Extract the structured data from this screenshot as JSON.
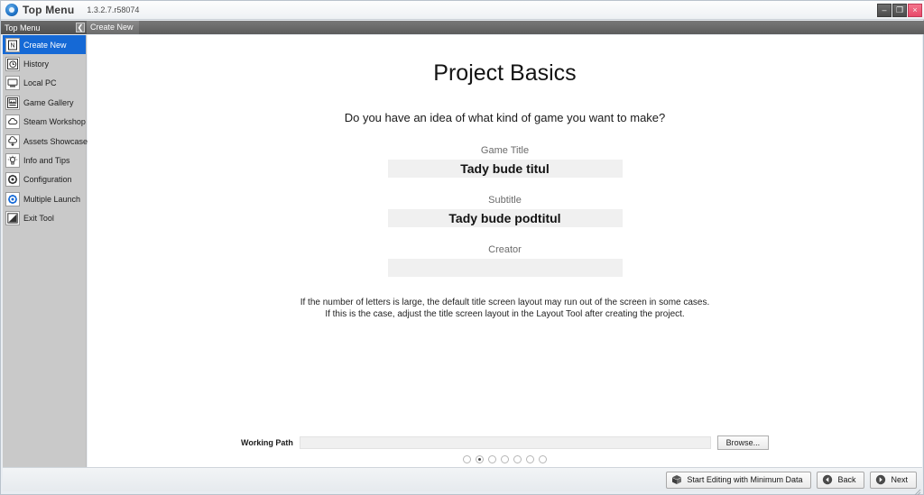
{
  "titlebar": {
    "app_title": "Top Menu",
    "version": "1.3.2.7.r58074",
    "app_icon": "gear-blue-icon",
    "minimize_label": "–",
    "maximize_label": "❐",
    "close_label": "×"
  },
  "subbar": {
    "panel_title": "Top Menu",
    "collapse_label": "❮",
    "tabs": [
      {
        "label": "Create New",
        "active": true
      }
    ]
  },
  "sidebar": {
    "items": [
      {
        "label": "Create New",
        "icon": "new-document-icon",
        "active": true
      },
      {
        "label": "History",
        "icon": "clock-history-icon",
        "active": false
      },
      {
        "label": "Local PC",
        "icon": "monitor-icon",
        "active": false
      },
      {
        "label": "Game Gallery",
        "icon": "gallery-image-icon",
        "active": false
      },
      {
        "label": "Steam Workshop",
        "icon": "cloud-icon",
        "active": false
      },
      {
        "label": "Assets Showcase",
        "icon": "cloud-download-icon",
        "active": false
      },
      {
        "label": "Info and Tips",
        "icon": "lightbulb-icon",
        "active": false
      },
      {
        "label": "Configuration",
        "icon": "gear-icon",
        "active": false
      },
      {
        "label": "Multiple Launch",
        "icon": "multi-gear-icon",
        "active": false
      },
      {
        "label": "Exit Tool",
        "icon": "exit-door-icon",
        "active": false
      }
    ]
  },
  "main": {
    "title": "Project Basics",
    "question": "Do you have an idea of what kind of game you want to make?",
    "fields": [
      {
        "label": "Game Title",
        "value": "Tady bude titul",
        "placeholder": ""
      },
      {
        "label": "Subtitle",
        "value": "Tady bude podtitul",
        "placeholder": ""
      },
      {
        "label": "Creator",
        "value": "",
        "placeholder": ""
      }
    ],
    "note_line1": "If the number of letters is large, the default title screen layout may run out of the screen in some cases.",
    "note_line2": "If this is the case, adjust the title screen layout in the Layout Tool after creating the project."
  },
  "working_path": {
    "label": "Working Path",
    "value": "",
    "placeholder": "",
    "browse_label": "Browse..."
  },
  "pagination": {
    "total": 7,
    "active_index": 1
  },
  "footer": {
    "buttons": [
      {
        "label": "Start Editing with Minimum Data",
        "icon": "box-icon"
      },
      {
        "label": "Back",
        "icon": "arrow-left-circle-icon"
      },
      {
        "label": "Next",
        "icon": "arrow-right-circle-icon"
      }
    ]
  },
  "colors": {
    "accent": "#1569d6",
    "close_button": "#e8496a",
    "panel_header": "#5f5f5f",
    "sidebar_bg": "#c9c9c9",
    "field_bg": "#f0f0f0"
  }
}
